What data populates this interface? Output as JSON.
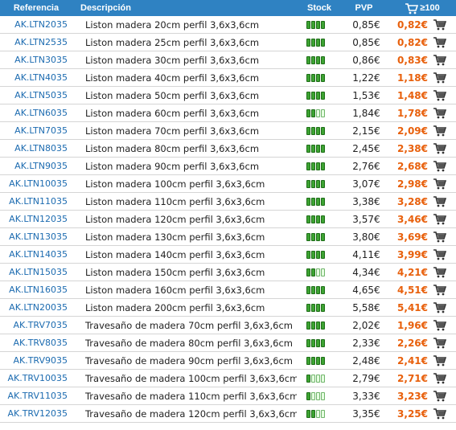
{
  "header": {
    "referencia": "Referencia",
    "descripcion": "Descripción",
    "stock": "Stock",
    "pvp": "PVP",
    "p100": "≥100"
  },
  "colors": {
    "header_bg": "#2f82c2",
    "ref_text": "#1c6bb0",
    "price_100": "#e8600c",
    "stock_fill": "#3da332"
  },
  "rows": [
    {
      "ref": "AK.LTN2035",
      "desc": "Liston madera 20cm perfil 3,6x3,6cm",
      "stock": 4,
      "pvp": "0,85€",
      "p100": "0,82€"
    },
    {
      "ref": "AK.LTN2535",
      "desc": "Liston madera 25cm perfil 3,6x3,6cm",
      "stock": 4,
      "pvp": "0,85€",
      "p100": "0,82€"
    },
    {
      "ref": "AK.LTN3035",
      "desc": "Liston madera 30cm perfil 3,6x3,6cm",
      "stock": 4,
      "pvp": "0,86€",
      "p100": "0,83€"
    },
    {
      "ref": "AK.LTN4035",
      "desc": "Liston madera 40cm perfil 3,6x3,6cm",
      "stock": 4,
      "pvp": "1,22€",
      "p100": "1,18€"
    },
    {
      "ref": "AK.LTN5035",
      "desc": "Liston madera 50cm perfil 3,6x3,6cm",
      "stock": 4,
      "pvp": "1,53€",
      "p100": "1,48€"
    },
    {
      "ref": "AK.LTN6035",
      "desc": "Liston madera 60cm perfil 3,6x3,6cm",
      "stock": 2,
      "pvp": "1,84€",
      "p100": "1,78€"
    },
    {
      "ref": "AK.LTN7035",
      "desc": "Liston madera 70cm perfil 3,6x3,6cm",
      "stock": 4,
      "pvp": "2,15€",
      "p100": "2,09€"
    },
    {
      "ref": "AK.LTN8035",
      "desc": "Liston madera 80cm perfil 3,6x3,6cm",
      "stock": 4,
      "pvp": "2,45€",
      "p100": "2,38€"
    },
    {
      "ref": "AK.LTN9035",
      "desc": "Liston madera 90cm perfil 3,6x3,6cm",
      "stock": 4,
      "pvp": "2,76€",
      "p100": "2,68€"
    },
    {
      "ref": "AK.LTN10035",
      "desc": "Liston madera 100cm perfil 3,6x3,6cm",
      "stock": 4,
      "pvp": "3,07€",
      "p100": "2,98€"
    },
    {
      "ref": "AK.LTN11035",
      "desc": "Liston madera 110cm perfil 3,6x3,6cm",
      "stock": 4,
      "pvp": "3,38€",
      "p100": "3,28€"
    },
    {
      "ref": "AK.LTN12035",
      "desc": "Liston madera 120cm perfil 3,6x3,6cm",
      "stock": 4,
      "pvp": "3,57€",
      "p100": "3,46€"
    },
    {
      "ref": "AK.LTN13035",
      "desc": "Liston madera 130cm perfil 3,6x3,6cm",
      "stock": 4,
      "pvp": "3,80€",
      "p100": "3,69€"
    },
    {
      "ref": "AK.LTN14035",
      "desc": "Liston madera 140cm perfil 3,6x3,6cm",
      "stock": 4,
      "pvp": "4,11€",
      "p100": "3,99€"
    },
    {
      "ref": "AK.LTN15035",
      "desc": "Liston madera 150cm perfil 3,6x3,6cm",
      "stock": 2,
      "pvp": "4,34€",
      "p100": "4,21€"
    },
    {
      "ref": "AK.LTN16035",
      "desc": "Liston madera 160cm perfil 3,6x3,6cm",
      "stock": 4,
      "pvp": "4,65€",
      "p100": "4,51€"
    },
    {
      "ref": "AK.LTN20035",
      "desc": "Liston madera 200cm perfil 3,6x3,6cm",
      "stock": 4,
      "pvp": "5,58€",
      "p100": "5,41€"
    },
    {
      "ref": "AK.TRV7035",
      "desc": "Travesaño de madera 70cm perfil  3,6x3,6cm",
      "stock": 4,
      "pvp": "2,02€",
      "p100": "1,96€"
    },
    {
      "ref": "AK.TRV8035",
      "desc": "Travesaño de madera 80cm perfil  3,6x3,6cm",
      "stock": 4,
      "pvp": "2,33€",
      "p100": "2,26€"
    },
    {
      "ref": "AK.TRV9035",
      "desc": "Travesaño de madera 90cm perfil  3,6x3,6cm",
      "stock": 4,
      "pvp": "2,48€",
      "p100": "2,41€"
    },
    {
      "ref": "AK.TRV10035",
      "desc": "Travesaño de madera 100cm perfil  3,6x3,6cm",
      "stock": 1,
      "pvp": "2,79€",
      "p100": "2,71€"
    },
    {
      "ref": "AK.TRV11035",
      "desc": "Travesaño de madera 110cm perfil  3,6x3,6cm",
      "stock": 1,
      "pvp": "3,33€",
      "p100": "3,23€"
    },
    {
      "ref": "AK.TRV12035",
      "desc": "Travesaño de madera 120cm perfil  3,6x3,6cm",
      "stock": 2,
      "pvp": "3,35€",
      "p100": "3,25€"
    }
  ],
  "icons": {
    "cart": "cart-icon",
    "stock": "stock-level-icon"
  }
}
